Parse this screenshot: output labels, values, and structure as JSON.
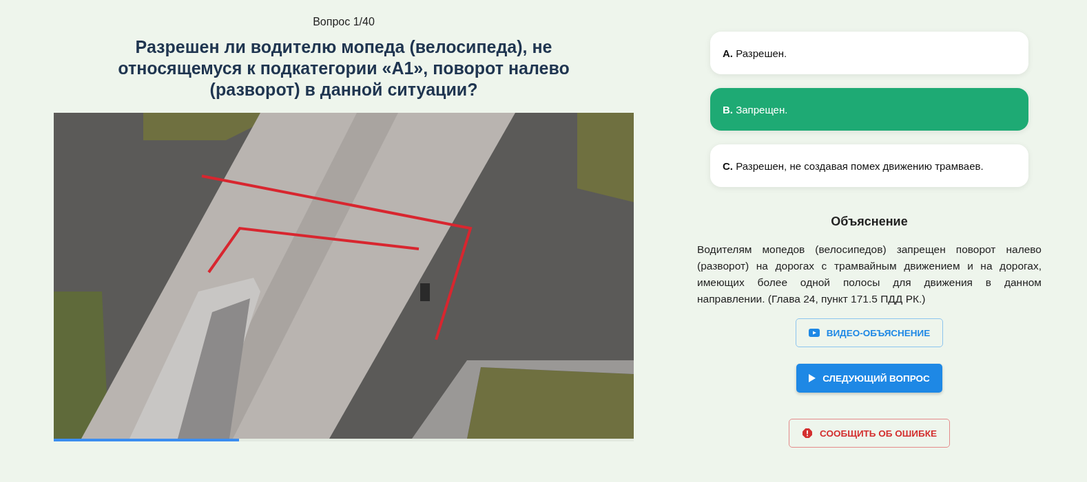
{
  "counter": "Вопрос 1/40",
  "question": "Разрешен ли водителю мопеда (велосипеда), не относящемуся к подкатегории «А1», поворот налево (разворот) в данной ситуации?",
  "media": {
    "kind": "picture",
    "level": 0.32
  },
  "answers": [
    {
      "letter": "A.",
      "text": "Разрешен.",
      "selected": false
    },
    {
      "letter": "B.",
      "text": "Запрещен.",
      "selected": true
    },
    {
      "letter": "C.",
      "text": "Разрешен, не создавая помех движению трамваев.",
      "selected": false
    }
  ],
  "explanation": {
    "title": "Объяснение",
    "text": "Водителям мопедов (велосипедов) запрещен поворот налево (разворот) на дорогах с трамвайным движением и на дорогах, имеющих более одной полосы для движения в данном направлении. (Глава 24, пункт 171.5 ПДД РК.)"
  },
  "buttons": [
    {
      "kind": "video",
      "label": "ВИДЕО-ОБЪЯСНЕНИЕ"
    },
    {
      "kind": "next",
      "label": "СЛЕДУЮЩИЙ ВОПРОС"
    },
    {
      "kind": "report",
      "label": "СООБЩИТЬ ОБ ОШИБКЕ"
    }
  ]
}
